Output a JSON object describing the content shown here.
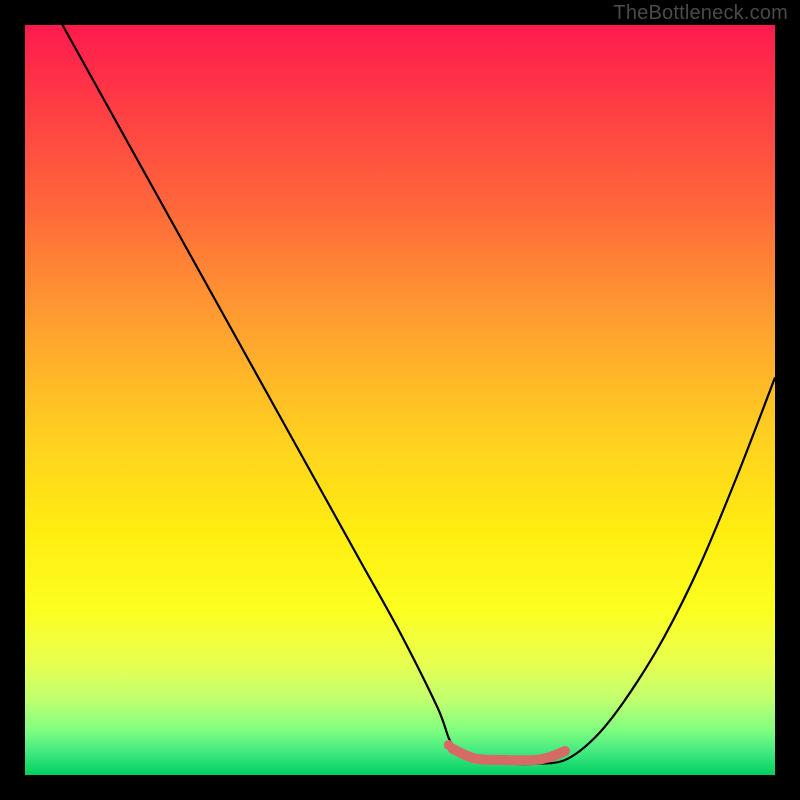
{
  "credit": "TheBottleneck.com",
  "chart_data": {
    "type": "line",
    "title": "",
    "xlabel": "",
    "ylabel": "",
    "xlim": [
      0,
      100
    ],
    "ylim": [
      0,
      100
    ],
    "grid": false,
    "legend": false,
    "series": [
      {
        "name": "curve",
        "color": "#000000",
        "x": [
          5,
          10,
          15,
          20,
          25,
          30,
          35,
          40,
          45,
          50,
          55,
          57,
          60,
          65,
          68,
          72,
          76,
          80,
          85,
          90,
          95,
          100
        ],
        "y": [
          100,
          91,
          82,
          73,
          64,
          55,
          46,
          37,
          28,
          19,
          9,
          4,
          2,
          1.5,
          1.5,
          2,
          5,
          10,
          18,
          28,
          40,
          53
        ]
      },
      {
        "name": "optimal-band",
        "color": "#d86a66",
        "x": [
          57,
          60,
          64,
          68,
          70,
          72
        ],
        "y": [
          3.5,
          2.2,
          2.0,
          2.0,
          2.4,
          3.2
        ]
      }
    ],
    "markers": [
      {
        "name": "optimal-dot",
        "x": 56.5,
        "y": 4,
        "r": 5,
        "color": "#d86a66"
      }
    ]
  }
}
